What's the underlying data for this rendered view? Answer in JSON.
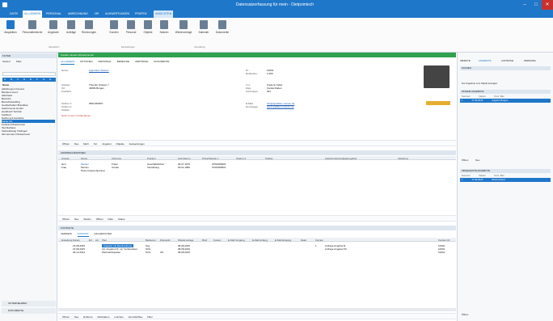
{
  "window": {
    "title": "Datensatzerfassung für mein - Dietpointech",
    "min": "–",
    "max": "□",
    "close": "✕"
  },
  "menu": {
    "tabs": [
      "DATEI",
      "ALLGEMEIN",
      "PERSONAL",
      "ABRECHNUNG",
      "HR",
      "AUSWERTUNGEN",
      "PRÜFEN",
      "ANSICHTEN"
    ],
    "active": 1
  },
  "ribbon": {
    "buttons": [
      "Akquisition",
      "Personalbereiche",
      "Angebote",
      "Aufträge",
      "Rechnungen",
      "Kunden",
      "Personal",
      "Objekte",
      "Notizen",
      "Wiedervorlage",
      "Kalender",
      "Dokumente"
    ],
    "groups": [
      "Akquisition",
      "Einstellungen",
      "Verwaltung"
    ]
  },
  "left": {
    "filter_hdr": "FILTER",
    "sort_label": "Sortiert",
    "filter_label": "Filter",
    "az": [
      "A",
      "B",
      "C",
      "D",
      "E",
      "F",
      "G",
      "H"
    ],
    "name_hdr": "Name",
    "items": [
      "Abbildungen Kamera",
      "Beispiel Lorenz",
      "Alterbasis",
      "Bereiche",
      "Bereichshandling",
      "Gerätschaften Brandbau",
      "Gastronomie GmbH",
      "Handbuch Technik",
      "Fastfood",
      "Nahrung & Getränke",
      "Kaiser AG",
      "Lieferant Mustermann",
      "Taxi Rathaus",
      "Verbandsweg Tuttlingen",
      "Zimmermann Mustermann"
    ],
    "selected": 10,
    "bottom": [
      "UNTERNEHMEN",
      "DOKUMENTE"
    ]
  },
  "center": {
    "header": "Kunden Jensen Schoebrunnen",
    "tabs": [
      "ALLGEMEIN",
      "OPTIONEN",
      "PERSONAL",
      "BEREICHE",
      "VERTRÄGE",
      "DOKUMENTE"
    ],
    "active_tab": 0,
    "fields": {
      "name_label": "Name:",
      "name_value": "Agentüren Kleinen",
      "street_label": "Strasse:",
      "street_value": "Theodor Strasse 7",
      "city_label": "Ort:",
      "city_value": "49699 Burgen",
      "zip_label": "Postfach:",
      "zip_value": "",
      "tel1_label": "Telefon 1:",
      "tel1_value": "0501/483357",
      "tel2_label": "Telefon 2:",
      "tel2_value": "",
      "fax_label": "Telefax:",
      "fax_value": "",
      "nr_label": "Nr.:",
      "nr_value": "10001",
      "deb_label": "Debitorkto.:",
      "deb_value": "1.650",
      "ansp_label": "z.H.:",
      "ansp_value": "Frederic Keller",
      "zeig_label": "Zeig.:",
      "zeig_value": "Carola Rüdes",
      "kd_label": "Kd-Gruppe:",
      "kd_value": "001",
      "mail_label": "E-Mail:",
      "mail_value": "info@quatklen-meinen.de",
      "web_label": "Homepage:",
      "web_value": "www.quatklen-meinen.de",
      "note": "Notiz zu dem Vorhandenen"
    },
    "tb1": [
      "Öffnen",
      "Neu",
      "Mehr",
      "Tel.",
      "Angebot",
      "Objekte",
      "Auswertungen"
    ],
    "ansp": {
      "hdr": "ANSPRECHPARTNER",
      "cols": [
        "Anrede",
        "Name",
        "Vorname",
        "Position",
        "Geb.Datum",
        "Privat/Telefon 1",
        "Telefon 2",
        "Telefax",
        "Zwischenfeld Aufgabengebiet",
        "Abteilung"
      ],
      "rows": [
        [
          "Herr",
          "Meinen",
          "Frank",
          "Geschäftsführer",
          "06.07.1975",
          "0700/480001",
          "",
          "",
          "",
          ""
        ],
        [
          "Frau",
          "Meinen",
          "Carola",
          "Verwaltung",
          "03.01.1982",
          "0700/480001",
          "",
          "",
          "",
          ""
        ],
        [
          "",
          "Petra Ansprechpartner",
          "",
          "",
          "",
          "",
          "",
          "",
          "",
          ""
        ]
      ]
    },
    "tb2": [
      "Öffnen",
      "Neu",
      "Telefon",
      "Öffnen",
      "Filter",
      "Status"
    ],
    "kontakte": {
      "hdr": "KONTAKTE",
      "tabs": [
        "VERWEIS",
        "KONTAKT",
        "NACHRICHTEN"
      ],
      "cols": [
        "Erstellung Datum",
        "Erl.",
        "Art",
        "Titel",
        "Bedienen",
        "Dispositiv",
        "Wiedervorlage",
        "Brief",
        "Kosten",
        "E-Mail Vorgang",
        "E-Mail Anfang",
        "E-Mail Eingang",
        "Datei",
        "Vorrats",
        "Kunden-Nr."
      ],
      "rows": [
        [
          "23.08.2015",
          "",
          "",
          "Angebot mit Beschreibung",
          "Svg",
          "",
          "08.08.2015",
          "",
          "",
          "",
          "",
          "",
          "",
          "1",
          "Anfrage Angebot R",
          "10001"
        ],
        [
          "15.08.2015",
          "",
          "",
          "AA. Angebot Nr. 12, Verbandssel",
          "SVS",
          "",
          "08.08.2015",
          "",
          "",
          "",
          "",
          "",
          "",
          "",
          "Anfrage Angebot 5C",
          "10001"
        ],
        [
          "06.12.2014",
          "",
          "",
          "Weihnachtspaste",
          "SVS",
          "OK",
          "08.08.2015",
          "",
          "",
          "",
          "",
          "",
          "",
          "",
          "",
          "10001"
        ]
      ]
    },
    "tb3": [
      "Öffnen",
      "Neu",
      "Entferne",
      "Notizdatum",
      "Löschen",
      "Vervollst/Neu",
      "Filter"
    ]
  },
  "right": {
    "tabs": [
      "OBJEKTE",
      "ANGEBOTE",
      "AUFTRÄGE",
      "PERSONAL"
    ],
    "active": 1,
    "sect1": "SUCHEN",
    "check": "Nur Angebote zum Objekt anzeigen",
    "sect2": "OFFENE ANGEBOTE",
    "cols": [
      "Nummer",
      "Datum",
      "Kurz. Bez."
    ],
    "rows": [
      [
        "1",
        "17.09.2015",
        "Angebot Burgen"
      ]
    ],
    "tb": [
      "Öffnen",
      "Neu"
    ],
    "sect3": "ABGELEHNTE ANGEBOTE",
    "rows2": [
      [
        "1",
        "17.06.2015",
        "Wochenhand"
      ]
    ],
    "bottom": "Öffnen"
  },
  "colors": {
    "accent": "#1f77c9",
    "green": "#2fa14f",
    "header": "#dde6ef"
  }
}
